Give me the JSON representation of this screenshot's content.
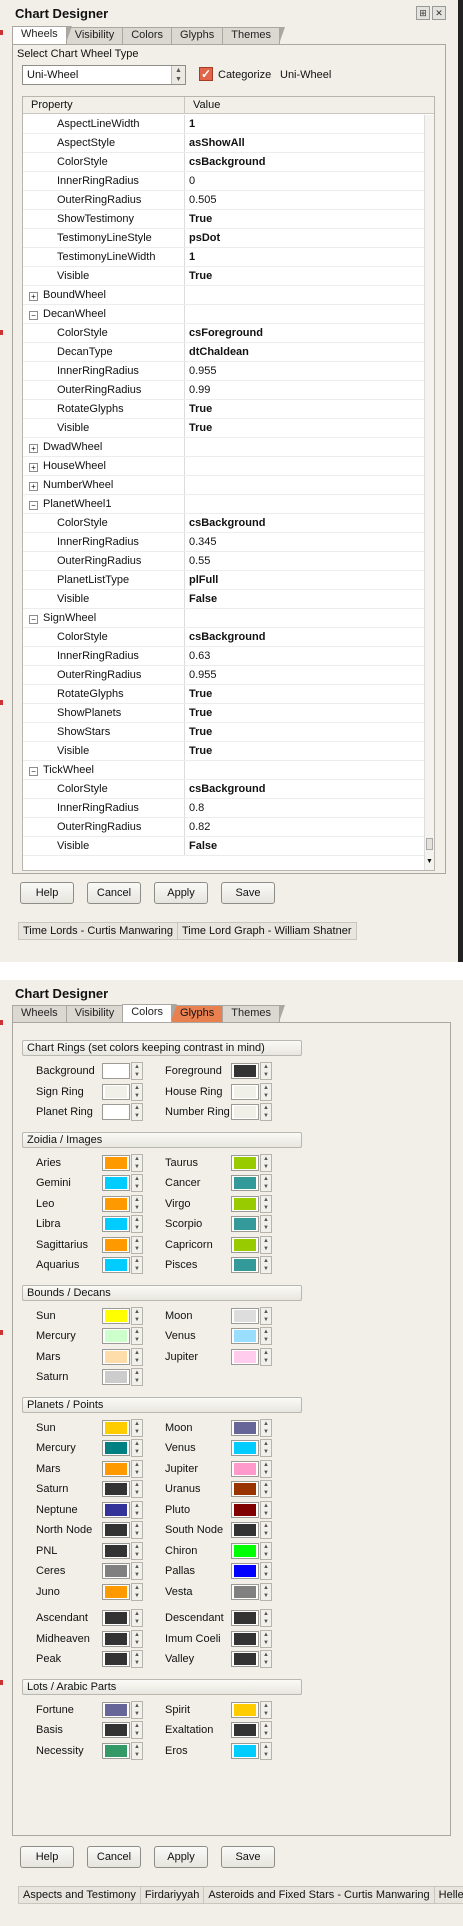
{
  "panel1": {
    "title": "Chart Designer",
    "tabs": [
      "Wheels",
      "Visibility",
      "Colors",
      "Glyphs",
      "Themes"
    ],
    "section_label": "Select Chart Wheel Type",
    "wheel_type": "Uni-Wheel",
    "categorize_label": "Categorize",
    "categorize_checked": true,
    "categorize_value": "Uni-Wheel",
    "grid_header": {
      "property": "Property",
      "value": "Value"
    },
    "rows": [
      {
        "kind": "child",
        "name": "AspectLineWidth",
        "value": "1",
        "bold": true
      },
      {
        "kind": "child",
        "name": "AspectStyle",
        "value": "asShowAll",
        "bold": true
      },
      {
        "kind": "child",
        "name": "ColorStyle",
        "value": "csBackground",
        "bold": true
      },
      {
        "kind": "child",
        "name": "InnerRingRadius",
        "value": "0",
        "bold": false
      },
      {
        "kind": "child",
        "name": "OuterRingRadius",
        "value": "0.505",
        "bold": false
      },
      {
        "kind": "child",
        "name": "ShowTestimony",
        "value": "True",
        "bold": true
      },
      {
        "kind": "child",
        "name": "TestimonyLineStyle",
        "value": "psDot",
        "bold": true
      },
      {
        "kind": "child",
        "name": "TestimonyLineWidth",
        "value": "1",
        "bold": true
      },
      {
        "kind": "child",
        "name": "Visible",
        "value": "True",
        "bold": true
      },
      {
        "kind": "group",
        "name": "BoundWheel",
        "value": "",
        "expanded": false
      },
      {
        "kind": "group",
        "name": "DecanWheel",
        "value": "",
        "expanded": true
      },
      {
        "kind": "child",
        "name": "ColorStyle",
        "value": "csForeground",
        "bold": true
      },
      {
        "kind": "child",
        "name": "DecanType",
        "value": "dtChaldean",
        "bold": true
      },
      {
        "kind": "child",
        "name": "InnerRingRadius",
        "value": "0.955",
        "bold": false
      },
      {
        "kind": "child",
        "name": "OuterRingRadius",
        "value": "0.99",
        "bold": false
      },
      {
        "kind": "child",
        "name": "RotateGlyphs",
        "value": "True",
        "bold": true
      },
      {
        "kind": "child",
        "name": "Visible",
        "value": "True",
        "bold": true
      },
      {
        "kind": "group",
        "name": "DwadWheel",
        "value": "",
        "expanded": false
      },
      {
        "kind": "group",
        "name": "HouseWheel",
        "value": "",
        "expanded": false
      },
      {
        "kind": "group",
        "name": "NumberWheel",
        "value": "",
        "expanded": false
      },
      {
        "kind": "group",
        "name": "PlanetWheel1",
        "value": "",
        "expanded": true
      },
      {
        "kind": "child",
        "name": "ColorStyle",
        "value": "csBackground",
        "bold": true
      },
      {
        "kind": "child",
        "name": "InnerRingRadius",
        "value": "0.345",
        "bold": false
      },
      {
        "kind": "child",
        "name": "OuterRingRadius",
        "value": "0.55",
        "bold": false
      },
      {
        "kind": "child",
        "name": "PlanetListType",
        "value": "plFull",
        "bold": true
      },
      {
        "kind": "child",
        "name": "Visible",
        "value": "False",
        "bold": true
      },
      {
        "kind": "group",
        "name": "SignWheel",
        "value": "",
        "expanded": true
      },
      {
        "kind": "child",
        "name": "ColorStyle",
        "value": "csBackground",
        "bold": true
      },
      {
        "kind": "child",
        "name": "InnerRingRadius",
        "value": "0.63",
        "bold": false
      },
      {
        "kind": "child",
        "name": "OuterRingRadius",
        "value": "0.955",
        "bold": false
      },
      {
        "kind": "child",
        "name": "RotateGlyphs",
        "value": "True",
        "bold": true
      },
      {
        "kind": "child",
        "name": "ShowPlanets",
        "value": "True",
        "bold": true
      },
      {
        "kind": "child",
        "name": "ShowStars",
        "value": "True",
        "bold": true
      },
      {
        "kind": "child",
        "name": "Visible",
        "value": "True",
        "bold": true
      },
      {
        "kind": "group",
        "name": "TickWheel",
        "value": "",
        "expanded": true
      },
      {
        "kind": "child",
        "name": "ColorStyle",
        "value": "csBackground",
        "bold": true
      },
      {
        "kind": "child",
        "name": "InnerRingRadius",
        "value": "0.8",
        "bold": false
      },
      {
        "kind": "child",
        "name": "OuterRingRadius",
        "value": "0.82",
        "bold": false
      },
      {
        "kind": "child",
        "name": "Visible",
        "value": "False",
        "bold": true
      }
    ],
    "buttons": {
      "help": "Help",
      "cancel": "Cancel",
      "apply": "Apply",
      "save": "Save"
    },
    "bottom_tabs": [
      "Time Lords - Curtis Manwaring",
      "Time Lord Graph - William Shatner"
    ]
  },
  "panel2": {
    "title": "Chart Designer",
    "tabs": [
      "Wheels",
      "Visibility",
      "Colors",
      "Glyphs",
      "Themes"
    ],
    "sections": [
      {
        "title": "Chart Rings (set colors keeping contrast in mind)",
        "items": [
          {
            "label": "Background",
            "color": "#ffffff"
          },
          {
            "label": "Foreground",
            "color": "#333333"
          },
          {
            "label": "Sign Ring",
            "color": "#f0efe8"
          },
          {
            "label": "House Ring",
            "color": "#f0efe8"
          },
          {
            "label": "Planet Ring",
            "color": "#ffffff"
          },
          {
            "label": "Number Ring",
            "color": "#f0efe8"
          }
        ]
      },
      {
        "title": "Zoidia / Images",
        "items": [
          {
            "label": "Aries",
            "color": "#ff9900"
          },
          {
            "label": "Taurus",
            "color": "#99cc00"
          },
          {
            "label": "Gemini",
            "color": "#00ccff"
          },
          {
            "label": "Cancer",
            "color": "#339999"
          },
          {
            "label": "Leo",
            "color": "#ff9900"
          },
          {
            "label": "Virgo",
            "color": "#99cc00"
          },
          {
            "label": "Libra",
            "color": "#00ccff"
          },
          {
            "label": "Scorpio",
            "color": "#339999"
          },
          {
            "label": "Sagittarius",
            "color": "#ff9900"
          },
          {
            "label": "Capricorn",
            "color": "#99cc00"
          },
          {
            "label": "Aquarius",
            "color": "#00ccff"
          },
          {
            "label": "Pisces",
            "color": "#339999"
          }
        ]
      },
      {
        "title": "Bounds / Decans",
        "items": [
          {
            "label": "Sun",
            "color": "#ffff00"
          },
          {
            "label": "Moon",
            "color": "#dddddd"
          },
          {
            "label": "Mercury",
            "color": "#ccffcc"
          },
          {
            "label": "Venus",
            "color": "#99ddff"
          },
          {
            "label": "Mars",
            "color": "#ffddaa"
          },
          {
            "label": "Jupiter",
            "color": "#ffccee"
          },
          {
            "label": "Saturn",
            "color": "#cccccc"
          }
        ]
      },
      {
        "title": "Planets / Points",
        "items": [
          {
            "label": "Sun",
            "color": "#ffcc00"
          },
          {
            "label": "Moon",
            "color": "#666699"
          },
          {
            "label": "Mercury",
            "color": "#008080"
          },
          {
            "label": "Venus",
            "color": "#00ccff"
          },
          {
            "label": "Mars",
            "color": "#ff9900"
          },
          {
            "label": "Jupiter",
            "color": "#ff99cc"
          },
          {
            "label": "Saturn",
            "color": "#333333"
          },
          {
            "label": "Uranus",
            "color": "#993300"
          },
          {
            "label": "Neptune",
            "color": "#333399"
          },
          {
            "label": "Pluto",
            "color": "#800000"
          },
          {
            "label": "North Node",
            "color": "#333333"
          },
          {
            "label": "South Node",
            "color": "#333333"
          },
          {
            "label": "PNL",
            "color": "#333333"
          },
          {
            "label": "Chiron",
            "color": "#00ff00"
          },
          {
            "label": "Ceres",
            "color": "#808080"
          },
          {
            "label": "Pallas",
            "color": "#0000ff"
          },
          {
            "label": "Juno",
            "color": "#ff9900"
          },
          {
            "label": "Vesta",
            "color": "#808080"
          },
          {
            "label": "Ascendant",
            "color": "#333333"
          },
          {
            "label": "Descendant",
            "color": "#333333"
          },
          {
            "label": "Midheaven",
            "color": "#333333"
          },
          {
            "label": "Imum Coeli",
            "color": "#333333"
          },
          {
            "label": "Peak",
            "color": "#333333"
          },
          {
            "label": "Valley",
            "color": "#333333"
          }
        ]
      },
      {
        "title": "Lots / Arabic Parts",
        "items": [
          {
            "label": "Fortune",
            "color": "#666699"
          },
          {
            "label": "Spirit",
            "color": "#ffcc00"
          },
          {
            "label": "Basis",
            "color": "#333333"
          },
          {
            "label": "Exaltation",
            "color": "#333333"
          },
          {
            "label": "Necessity",
            "color": "#339966"
          },
          {
            "label": "Eros",
            "color": "#00ccff"
          }
        ]
      }
    ],
    "buttons": {
      "help": "Help",
      "cancel": "Cancel",
      "apply": "Apply",
      "save": "Save"
    },
    "bottom_tabs": [
      "Aspects and Testimony",
      "Firdariyyah",
      "Asteroids and Fixed Stars - Curtis Manwaring",
      "Heller"
    ]
  }
}
